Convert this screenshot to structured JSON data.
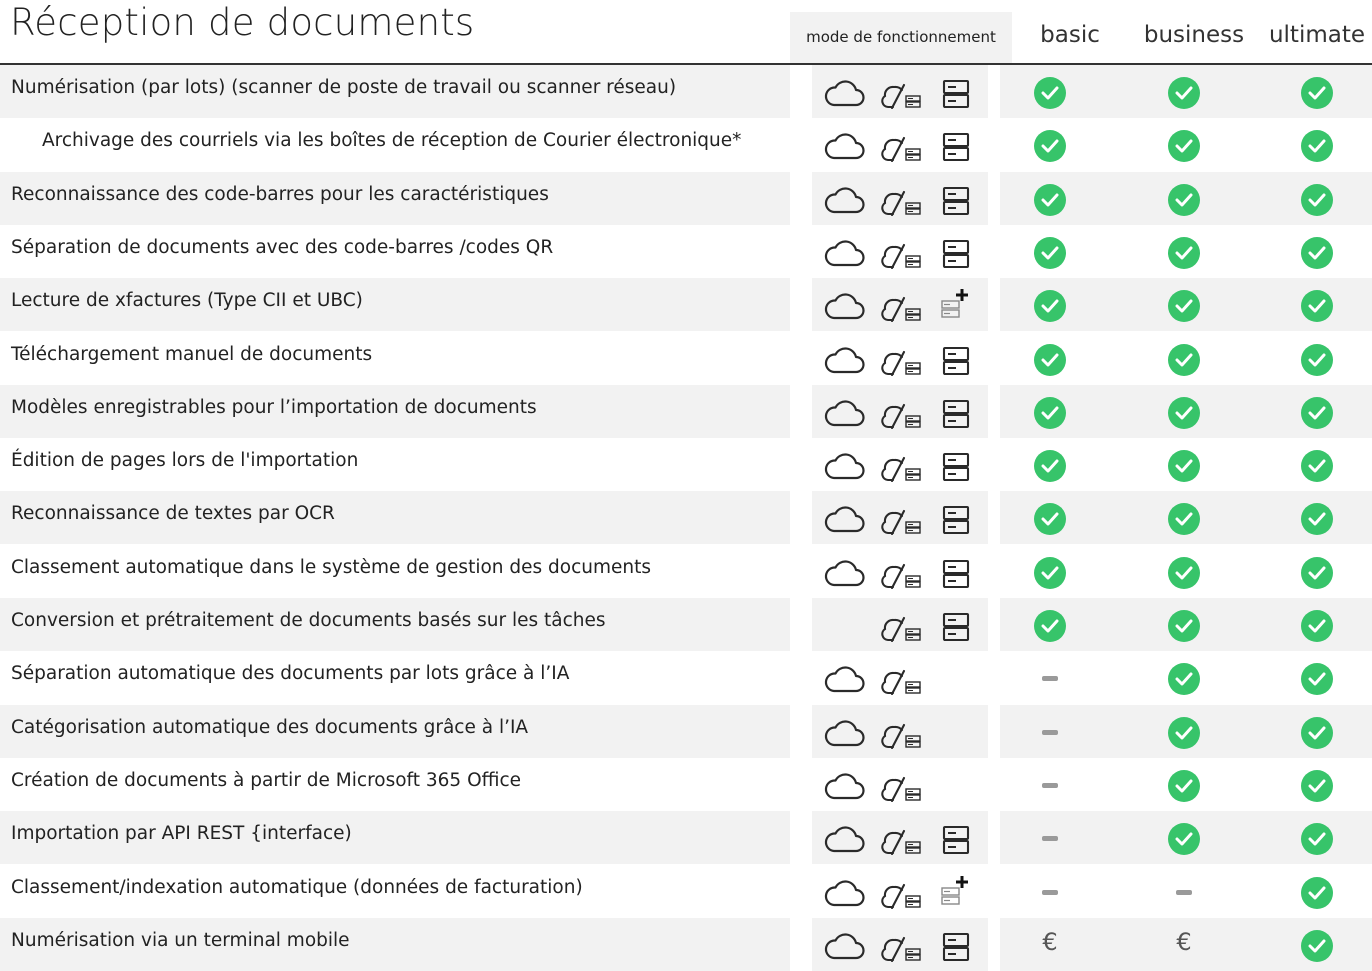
{
  "title": "Réception de documents",
  "header": {
    "mode": "mode de fonctionnement",
    "plans": [
      "basic",
      "business",
      "ultimate"
    ]
  },
  "symbols": {
    "check": "check-icon",
    "dash": "–",
    "paid": "€"
  },
  "colors": {
    "check": "#37c46a",
    "dash": "#9a9a9a",
    "shade": "#f2f2f2"
  },
  "rows": [
    {
      "label": "Numérisation (par lots) (scanner de poste de travail ou scanner réseau)",
      "indent": false,
      "modes": [
        "cloud",
        "hybrid",
        "server"
      ],
      "plans": [
        "check",
        "check",
        "check"
      ]
    },
    {
      "label": "Archivage des courriels via les boîtes de réception de Courier électronique*",
      "indent": true,
      "modes": [
        "cloud",
        "hybrid",
        "server"
      ],
      "plans": [
        "check",
        "check",
        "check"
      ]
    },
    {
      "label": "Reconnaissance des code-barres pour les caractéristiques",
      "indent": false,
      "modes": [
        "cloud",
        "hybrid",
        "server"
      ],
      "plans": [
        "check",
        "check",
        "check"
      ]
    },
    {
      "label": "Séparation de documents avec des code-barres /codes QR",
      "indent": false,
      "modes": [
        "cloud",
        "hybrid",
        "server"
      ],
      "plans": [
        "check",
        "check",
        "check"
      ]
    },
    {
      "label": "Lecture de xfactures (Type CII et UBC)",
      "indent": false,
      "modes": [
        "cloud",
        "hybrid",
        "server-plus"
      ],
      "plans": [
        "check",
        "check",
        "check"
      ]
    },
    {
      "label": "Téléchargement manuel de documents",
      "indent": false,
      "modes": [
        "cloud",
        "hybrid",
        "server"
      ],
      "plans": [
        "check",
        "check",
        "check"
      ]
    },
    {
      "label": "Modèles enregistrables pour l’importation de documents",
      "indent": false,
      "modes": [
        "cloud",
        "hybrid",
        "server"
      ],
      "plans": [
        "check",
        "check",
        "check"
      ]
    },
    {
      "label": "Édition de pages lors de l'importation",
      "indent": false,
      "modes": [
        "cloud",
        "hybrid",
        "server"
      ],
      "plans": [
        "check",
        "check",
        "check"
      ]
    },
    {
      "label": "Reconnaissance de textes par OCR",
      "indent": false,
      "modes": [
        "cloud",
        "hybrid",
        "server"
      ],
      "plans": [
        "check",
        "check",
        "check"
      ]
    },
    {
      "label": "Classement automatique dans le système de gestion des documents",
      "indent": false,
      "modes": [
        "cloud",
        "hybrid",
        "server"
      ],
      "plans": [
        "check",
        "check",
        "check"
      ]
    },
    {
      "label": "Conversion et prétraitement de documents basés sur les tâches",
      "indent": false,
      "modes": [
        "hybrid",
        "server"
      ],
      "plans": [
        "check",
        "check",
        "check"
      ]
    },
    {
      "label": "Séparation automatique des documents par lots grâce à l’IA",
      "indent": false,
      "modes": [
        "cloud",
        "hybrid"
      ],
      "plans": [
        "dash",
        "check",
        "check"
      ]
    },
    {
      "label": "Catégorisation automatique des documents grâce à l’IA",
      "indent": false,
      "modes": [
        "cloud",
        "hybrid"
      ],
      "plans": [
        "dash",
        "check",
        "check"
      ]
    },
    {
      "label": "Création de documents à partir de Microsoft 365 Office",
      "indent": false,
      "modes": [
        "cloud",
        "hybrid"
      ],
      "plans": [
        "dash",
        "check",
        "check"
      ]
    },
    {
      "label": "Importation par API REST {interface)",
      "indent": false,
      "modes": [
        "cloud",
        "hybrid",
        "server"
      ],
      "plans": [
        "dash",
        "check",
        "check"
      ]
    },
    {
      "label": "Classement/indexation automatique (données de facturation)",
      "indent": false,
      "modes": [
        "cloud",
        "hybrid",
        "server-plus"
      ],
      "plans": [
        "dash",
        "dash",
        "check"
      ]
    },
    {
      "label": "Numérisation via un terminal mobile",
      "indent": false,
      "modes": [
        "cloud",
        "hybrid",
        "server"
      ],
      "plans": [
        "paid",
        "paid",
        "check"
      ]
    }
  ]
}
